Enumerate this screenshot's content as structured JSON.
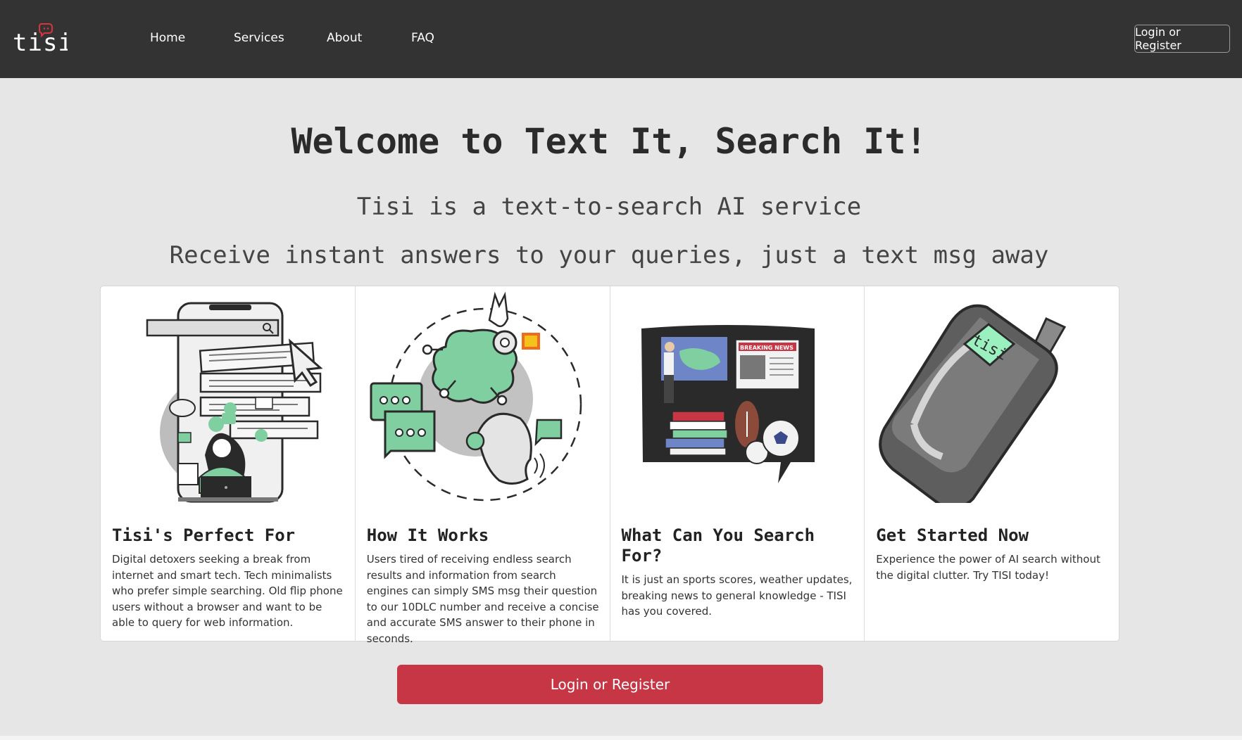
{
  "header": {
    "logo_text": "tisi",
    "nav": [
      "Home",
      "Services",
      "About",
      "FAQ"
    ],
    "login_label": "Login or Register"
  },
  "hero": {
    "title": "Welcome to Text It, Search It!",
    "subtitle": "Tisi is a text-to-search AI service",
    "tagline": "Receive instant answers to your queries, just a text msg away"
  },
  "cards": [
    {
      "title": "Tisi's Perfect For",
      "text": "Digital detoxers seeking a break from internet and smart tech. Tech minimalists who prefer simple searching. Old flip phone users without a browser and want to be able to query for web information."
    },
    {
      "title": "How It Works",
      "text": "Users tired of receiving endless search results and information from search engines can simply SMS msg their question to our 10DLC number and receive a concise and accurate SMS answer to their phone in seconds."
    },
    {
      "title": "What Can You Search For?",
      "text": "It is just an sports scores, weather updates, breaking news to general knowledge - TISI has you covered."
    },
    {
      "title": "Get Started Now",
      "text": "Experience the power of AI search without the digital clutter. Try TISI today!"
    }
  ],
  "illustration_labels": {
    "breaking_news": "BREAKING NEWS",
    "phone_screen": "tisi"
  },
  "cta_label": "Login or Register",
  "colors": {
    "header_bg": "#333333",
    "page_bg": "#e6e6e6",
    "cta": "#c73645",
    "accent_green": "#7fcfa0"
  }
}
